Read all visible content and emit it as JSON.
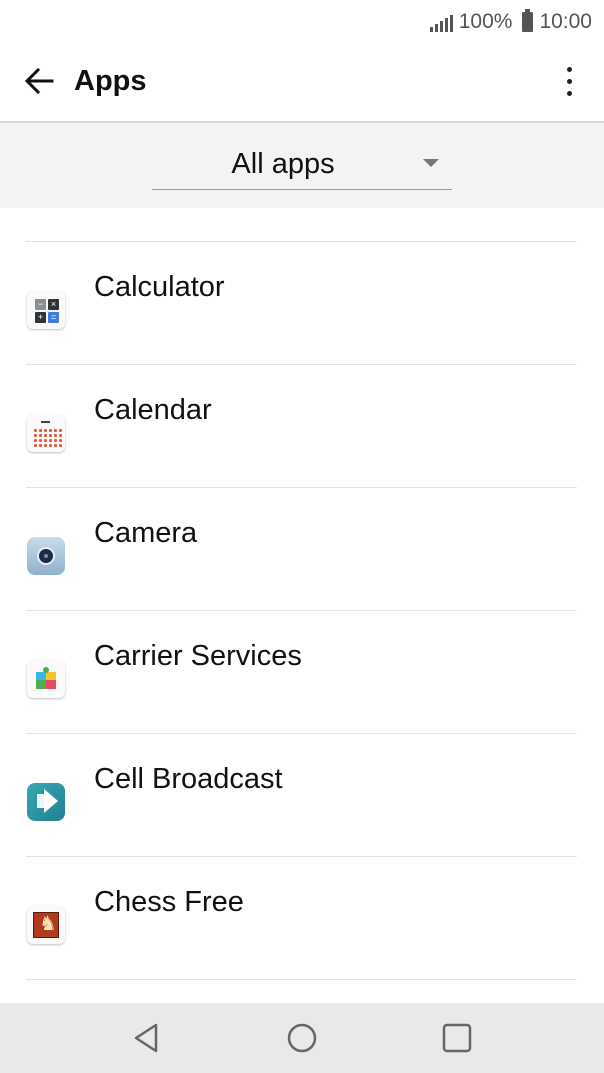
{
  "status_bar": {
    "battery_percent": "100%",
    "time": "10:00",
    "icons": [
      "signal-icon",
      "battery-icon"
    ]
  },
  "app_bar": {
    "title": "Apps",
    "back_icon": "arrow-left-icon",
    "menu_icon": "more-vert-icon"
  },
  "filter": {
    "selected": "All apps",
    "arrow_icon": "dropdown-arrow-icon"
  },
  "apps": [
    {
      "label": "Calculator",
      "icon": "calculator-icon"
    },
    {
      "label": "Calendar",
      "icon": "calendar-icon"
    },
    {
      "label": "Camera",
      "icon": "camera-icon"
    },
    {
      "label": "Carrier Services",
      "icon": "carrier-services-icon"
    },
    {
      "label": "Cell Broadcast",
      "icon": "cell-broadcast-icon"
    },
    {
      "label": "Chess Free",
      "icon": "chess-free-icon"
    }
  ],
  "nav_bar": {
    "icons": [
      "back-nav-icon",
      "home-nav-icon",
      "recents-nav-icon"
    ]
  },
  "colors": {
    "filter_background": "#f3f3f3",
    "nav_background": "#e8e9eb",
    "divider": "#e3e3e3"
  }
}
